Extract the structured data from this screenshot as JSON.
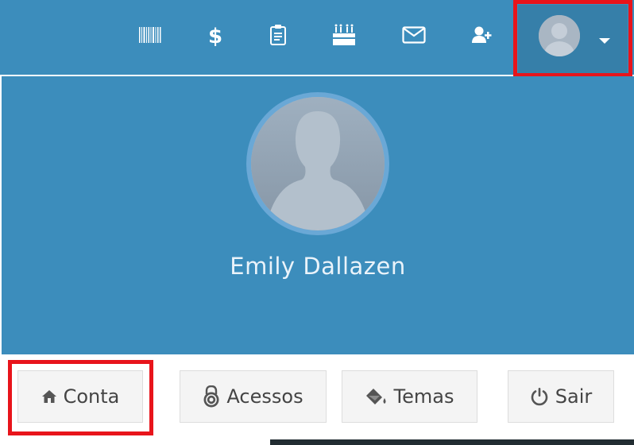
{
  "navbar": {
    "icons": [
      {
        "name": "barcode-icon"
      },
      {
        "name": "dollar-icon"
      },
      {
        "name": "clipboard-icon"
      },
      {
        "name": "birthday-cake-icon"
      },
      {
        "name": "envelope-icon"
      },
      {
        "name": "user-plus-icon"
      }
    ],
    "user_menu": {
      "avatar": "user-avatar",
      "caret": "caret-down-icon"
    }
  },
  "user_panel": {
    "name": "Emily Dallazen"
  },
  "footer_buttons": {
    "conta": {
      "label": "Conta",
      "icon": "home-icon"
    },
    "acessos": {
      "label": "Acessos",
      "icon": "padlock-icon"
    },
    "temas": {
      "label": "Temas",
      "icon": "paint-bucket-icon"
    },
    "sair": {
      "label": "Sair",
      "icon": "power-icon"
    }
  },
  "colors": {
    "header_blue": "#3c8dbc",
    "header_blue_dark": "#367fa9",
    "highlight_red": "#e8141b",
    "button_bg": "#f4f4f4",
    "button_text": "#444444"
  }
}
